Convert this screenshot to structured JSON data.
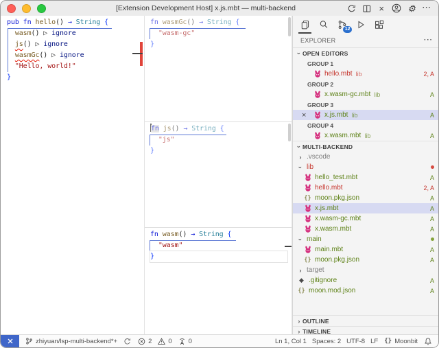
{
  "colors": {
    "accent_badge_blue": "#2a6fce",
    "remote_blue": "#3f66c9",
    "selection_lavender": "#d7daf2",
    "git_added_green": "#5d8116",
    "error_red": "#c5342b",
    "moonbit_pink": "#d5327f",
    "traffic": {
      "close": "#ff5f57",
      "minimize": "#febc2e",
      "zoom": "#28c840"
    }
  },
  "title_bar": {
    "title": "[Extension Development Host] x.js.mbt — multi-backend",
    "actions": [
      "restart-extension-host",
      "split-editor",
      "close",
      "account",
      "settings",
      "more"
    ]
  },
  "editors": {
    "left": {
      "file": "hello.mbt",
      "lines": [
        {
          "tokens": [
            {
              "c": "kw",
              "t": "pub fn "
            },
            {
              "c": "fn",
              "t": "hello"
            },
            {
              "c": "pt",
              "t": "() "
            },
            {
              "c": "arr",
              "t": "→ "
            },
            {
              "c": "ty",
              "t": "String "
            },
            {
              "c": "br",
              "t": "{"
            }
          ]
        },
        {
          "tokens": [
            {
              "c": "pt",
              "t": "  "
            },
            {
              "c": "fn",
              "t": "wasm"
            },
            {
              "c": "pt",
              "t": "() "
            },
            {
              "c": "op",
              "t": "▷ "
            },
            {
              "c": "id",
              "t": "ignore"
            }
          ]
        },
        {
          "tokens": [
            {
              "c": "pt",
              "t": "  "
            },
            {
              "c": "fn sq",
              "t": "js"
            },
            {
              "c": "pt",
              "t": "() "
            },
            {
              "c": "op",
              "t": "▷ "
            },
            {
              "c": "id",
              "t": "ignore"
            }
          ]
        },
        {
          "tokens": [
            {
              "c": "pt",
              "t": "  "
            },
            {
              "c": "fn sq",
              "t": "wasmGc"
            },
            {
              "c": "pt",
              "t": "() "
            },
            {
              "c": "op",
              "t": "▷ "
            },
            {
              "c": "id",
              "t": "ignore"
            }
          ]
        },
        {
          "tokens": [
            {
              "c": "pt",
              "t": "  "
            },
            {
              "c": "st",
              "t": "\"Hello, world!\""
            }
          ]
        },
        {
          "tokens": [
            {
              "c": "br",
              "t": "}"
            }
          ]
        }
      ]
    },
    "stack": [
      {
        "file": "x.wasm-gc.mbt",
        "dimmed": true,
        "lines": [
          {
            "tokens": [
              {
                "c": "kw",
                "t": "fn "
              },
              {
                "c": "fn",
                "t": "wasmGc"
              },
              {
                "c": "pt",
                "t": "() "
              },
              {
                "c": "arr",
                "t": "→ "
              },
              {
                "c": "ty",
                "t": "String "
              },
              {
                "c": "br",
                "t": "{"
              }
            ]
          },
          {
            "tokens": [
              {
                "c": "pt",
                "t": "  "
              },
              {
                "c": "st",
                "t": "\"wasm-gc\""
              }
            ]
          },
          {
            "tokens": [
              {
                "c": "br",
                "t": "}"
              }
            ]
          }
        ]
      },
      {
        "file": "x.js.mbt",
        "dimmed": true,
        "lines": [
          {
            "tokens": [
              {
                "c": "cursor",
                "t": ""
              },
              {
                "c": "kw boxed",
                "t": "fn"
              },
              {
                "c": "pt",
                "t": " "
              },
              {
                "c": "fn",
                "t": "js"
              },
              {
                "c": "pt",
                "t": "() "
              },
              {
                "c": "arr",
                "t": "→ "
              },
              {
                "c": "ty",
                "t": "String "
              },
              {
                "c": "br",
                "t": "{"
              }
            ]
          },
          {
            "tokens": [
              {
                "c": "pt",
                "t": "  "
              },
              {
                "c": "st",
                "t": "\"js\""
              }
            ]
          },
          {
            "tokens": [
              {
                "c": "br",
                "t": "}"
              }
            ]
          }
        ]
      },
      {
        "file": "x.wasm.mbt",
        "dimmed": false,
        "lines": [
          {
            "tokens": [
              {
                "c": "kw",
                "t": "fn "
              },
              {
                "c": "fn",
                "t": "wasm"
              },
              {
                "c": "pt",
                "t": "() "
              },
              {
                "c": "arr",
                "t": "→ "
              },
              {
                "c": "ty",
                "t": "String "
              },
              {
                "c": "br",
                "t": "{"
              }
            ]
          },
          {
            "tokens": [
              {
                "c": "pt",
                "t": "  "
              },
              {
                "c": "st",
                "t": "\"wasm\""
              }
            ]
          },
          {
            "cls": "cur-line",
            "tokens": [
              {
                "c": "br",
                "t": "}"
              }
            ]
          }
        ]
      }
    ]
  },
  "sidebar": {
    "activity": [
      {
        "icon": "files",
        "active": true
      },
      {
        "icon": "search"
      },
      {
        "icon": "source-control",
        "badge": "12"
      },
      {
        "icon": "debug"
      },
      {
        "icon": "extensions"
      }
    ],
    "explorer_title": "EXPLORER",
    "explorer_more": "···",
    "open_editors": {
      "label": "OPEN EDITORS",
      "rows": [
        {
          "type": "group",
          "label": "GROUP 1"
        },
        {
          "type": "file",
          "icon": "moonbit",
          "label": "hello.mbt",
          "desc": "lib",
          "badge": "2, A",
          "color": "red"
        },
        {
          "type": "group",
          "label": "GROUP 2"
        },
        {
          "type": "file",
          "icon": "moonbit",
          "label": "x.wasm-gc.mbt",
          "desc": "lib",
          "badge": "A",
          "color": "green"
        },
        {
          "type": "group",
          "label": "GROUP 3"
        },
        {
          "type": "file",
          "icon": "moonbit",
          "label": "x.js.mbt",
          "desc": "lib",
          "badge": "A",
          "color": "green",
          "selected": true,
          "close": "×"
        },
        {
          "type": "group",
          "label": "GROUP 4"
        },
        {
          "type": "file",
          "icon": "moonbit",
          "label": "x.wasm.mbt",
          "desc": "lib",
          "badge": "A",
          "color": "green"
        }
      ]
    },
    "workspace": {
      "label": "MULTI-BACKEND",
      "rows": [
        {
          "kind": "folder",
          "chevron": "right",
          "label": ".vscode",
          "color": "grey",
          "depth": 0
        },
        {
          "kind": "folder",
          "chevron": "down",
          "label": "lib",
          "color": "red",
          "depth": 0,
          "dot": "red"
        },
        {
          "kind": "file",
          "icon": "moonbit",
          "label": "hello_test.mbt",
          "color": "green",
          "depth": 1,
          "badge": "A"
        },
        {
          "kind": "file",
          "icon": "moonbit",
          "label": "hello.mbt",
          "color": "red",
          "depth": 1,
          "badge": "2, A"
        },
        {
          "kind": "file",
          "icon": "json",
          "label": "moon.pkg.json",
          "color": "green",
          "depth": 1,
          "badge": "A"
        },
        {
          "kind": "file",
          "icon": "moonbit",
          "label": "x.js.mbt",
          "color": "green",
          "depth": 1,
          "badge": "A",
          "selected": true
        },
        {
          "kind": "file",
          "icon": "moonbit",
          "label": "x.wasm-gc.mbt",
          "color": "green",
          "depth": 1,
          "badge": "A"
        },
        {
          "kind": "file",
          "icon": "moonbit",
          "label": "x.wasm.mbt",
          "color": "green",
          "depth": 1,
          "badge": "A"
        },
        {
          "kind": "folder",
          "chevron": "down",
          "label": "main",
          "color": "green",
          "depth": 0,
          "dot": "green"
        },
        {
          "kind": "file",
          "icon": "moonbit",
          "label": "main.mbt",
          "color": "green",
          "depth": 1,
          "badge": "A"
        },
        {
          "kind": "file",
          "icon": "json",
          "label": "moon.pkg.json",
          "color": "green",
          "depth": 1,
          "badge": "A"
        },
        {
          "kind": "folder",
          "chevron": "right",
          "label": "target",
          "color": "grey",
          "depth": 0
        },
        {
          "kind": "file",
          "icon": "gitignore",
          "label": ".gitignore",
          "color": "green",
          "depth": 0,
          "badge": "A"
        },
        {
          "kind": "file",
          "icon": "json",
          "label": "moon.mod.json",
          "color": "green",
          "depth": 0,
          "badge": "A"
        }
      ]
    },
    "outline_label": "OUTLINE",
    "timeline_label": "TIMELINE"
  },
  "status_bar": {
    "left": [
      {
        "name": "git-branch",
        "icon": "branch",
        "label": "zhiyuan/lsp-multi-backend*+"
      },
      {
        "name": "sync-changes",
        "icon": "sync",
        "label": ""
      },
      {
        "name": "errors",
        "icon": "error",
        "label": "2"
      },
      {
        "name": "warnings",
        "icon": "warning",
        "label": "0"
      },
      {
        "name": "ports",
        "icon": "ports",
        "label": "0"
      }
    ],
    "right": [
      {
        "name": "cursor-position",
        "label": "Ln 1, Col 1"
      },
      {
        "name": "indentation",
        "label": "Spaces: 2"
      },
      {
        "name": "encoding",
        "label": "UTF-8"
      },
      {
        "name": "eol",
        "label": "LF"
      },
      {
        "name": "language-mode",
        "icon": "braces",
        "label": "Moonbit"
      },
      {
        "name": "notifications",
        "icon": "bell",
        "label": ""
      }
    ]
  }
}
